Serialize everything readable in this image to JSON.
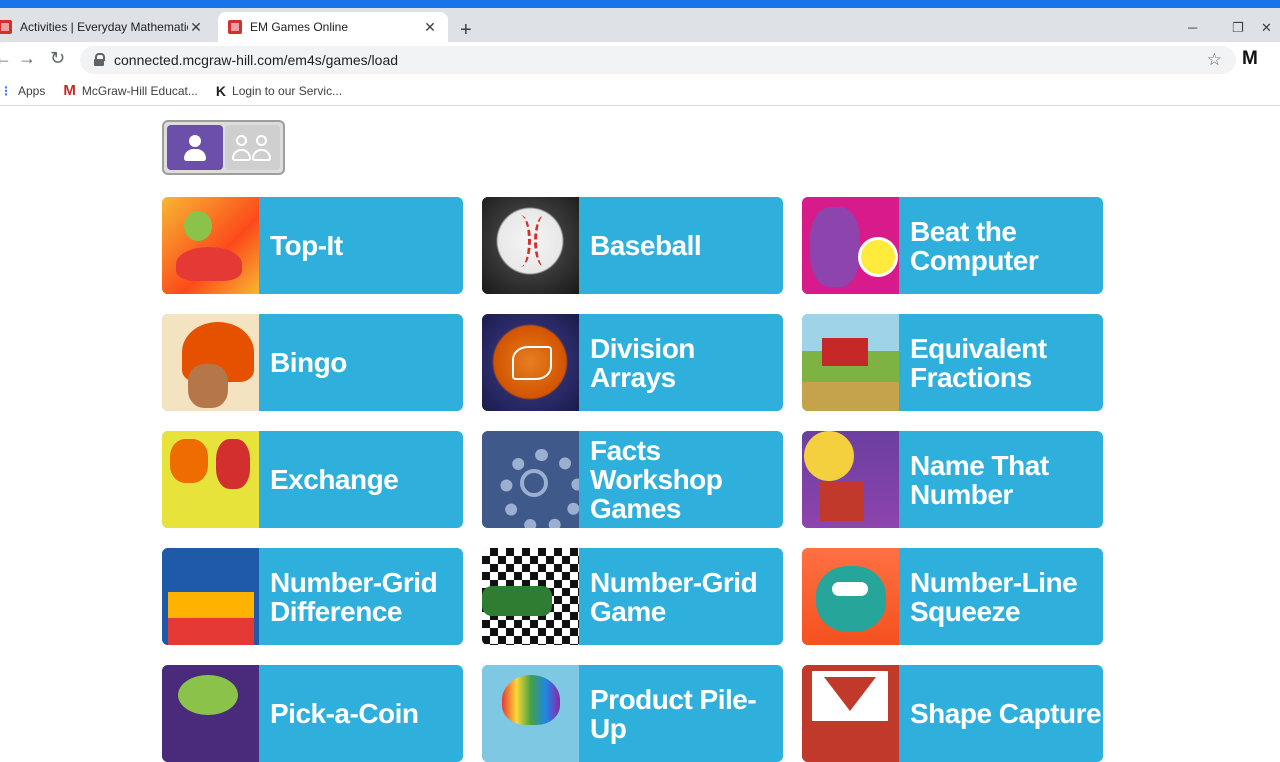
{
  "browser": {
    "tabs": [
      {
        "title": "Activities | Everyday Mathematics",
        "active": false
      },
      {
        "title": "EM Games Online",
        "active": true
      }
    ],
    "new_tab_symbol": "+",
    "url": "connected.mcgraw-hill.com/em4s/games/load",
    "profile_initials": "M",
    "bookmarks": [
      {
        "label": "Apps"
      },
      {
        "label": "McGraw-Hill Educat..."
      },
      {
        "label": "Login to our Servic..."
      }
    ]
  },
  "colors": {
    "card_background": "#2fb0dc",
    "toggle_active": "#6b4fa8",
    "browser_accent": "#1a73e8"
  },
  "mode_toggle": {
    "selected": "single-player",
    "options": [
      "single-player-icon",
      "multi-player-icon"
    ]
  },
  "games": [
    {
      "label": "Top-It"
    },
    {
      "label": "Baseball"
    },
    {
      "label": "Beat the Computer"
    },
    {
      "label": "Bingo"
    },
    {
      "label": "Division Arrays"
    },
    {
      "label": "Equivalent Fractions"
    },
    {
      "label": "Exchange"
    },
    {
      "label": "Facts Workshop Games"
    },
    {
      "label": "Name That Number"
    },
    {
      "label": "Number-Grid Difference"
    },
    {
      "label": "Number-Grid Game"
    },
    {
      "label": "Number-Line Squeeze"
    },
    {
      "label": "Pick-a-Coin"
    },
    {
      "label": "Product Pile-Up"
    },
    {
      "label": "Shape Capture"
    }
  ]
}
